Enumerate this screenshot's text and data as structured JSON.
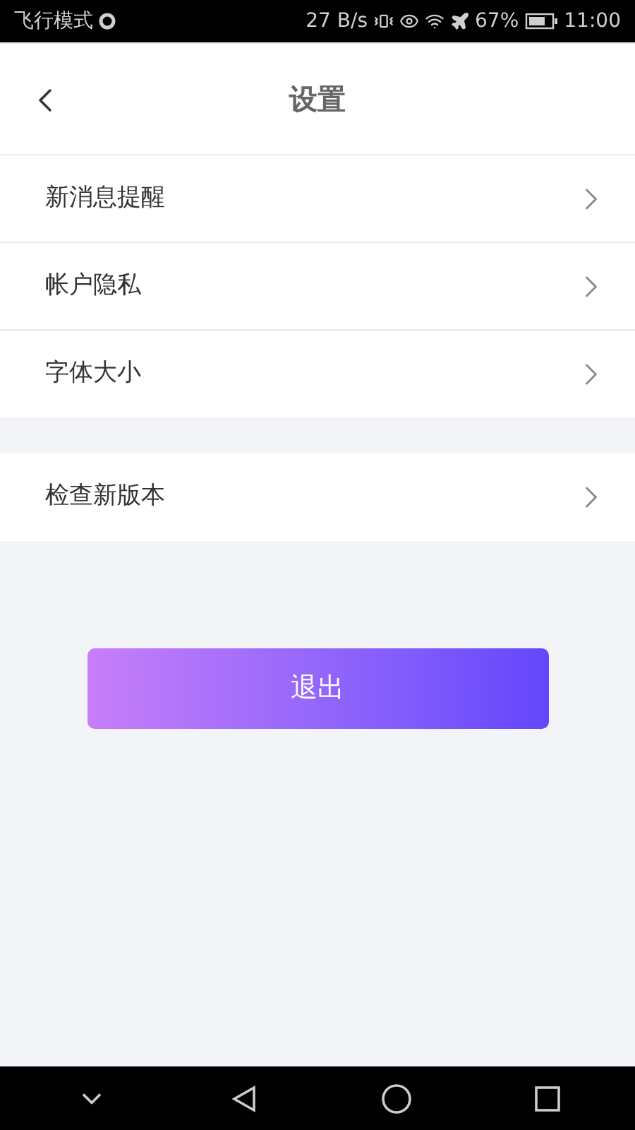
{
  "status_bar": {
    "mode": "飞行模式",
    "speed": "27 B/s",
    "battery": "67%",
    "time": "11:00"
  },
  "header": {
    "title": "设置"
  },
  "groups": [
    {
      "items": [
        {
          "label": "新消息提醒"
        },
        {
          "label": "帐户隐私"
        },
        {
          "label": "字体大小"
        }
      ]
    },
    {
      "items": [
        {
          "label": "检查新版本"
        }
      ]
    }
  ],
  "logout_button": "退出"
}
